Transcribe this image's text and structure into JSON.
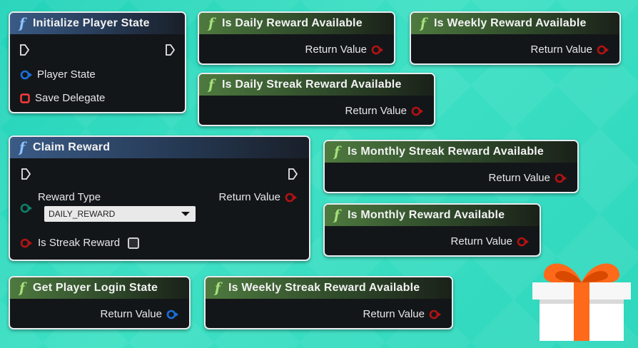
{
  "nodes": {
    "initialize_player_state": {
      "title": "Initialize Player State",
      "inputs": [
        "Player State",
        "Save Delegate"
      ]
    },
    "is_daily_reward_available": {
      "title": "Is Daily Reward Available",
      "output": "Return Value"
    },
    "is_weekly_reward_available": {
      "title": "Is Weekly Reward Available",
      "output": "Return Value"
    },
    "is_daily_streak_reward_available": {
      "title": "Is Daily Streak Reward Available",
      "output": "Return Value"
    },
    "claim_reward": {
      "title": "Claim Reward",
      "reward_type_label": "Reward Type",
      "reward_type_value": "DAILY_REWARD",
      "is_streak_label": "Is Streak Reward",
      "output": "Return Value"
    },
    "is_monthly_streak_reward_available": {
      "title": "Is Monthly Streak Reward Available",
      "output": "Return Value"
    },
    "is_monthly_reward_available": {
      "title": "Is Monthly Reward Available",
      "output": "Return Value"
    },
    "get_player_login_state": {
      "title": "Get Player Login State",
      "output": "Return Value"
    },
    "is_weekly_streak_reward_available": {
      "title": "Is Weekly Streak Reward Available",
      "output": "Return Value"
    }
  },
  "colors": {
    "bool_pin": "#b31212",
    "object_pin": "#1a6fd9",
    "enum_pin": "#0f7f6a",
    "delegate_pin": "#ff3b3b",
    "blue_header": "#3a5b86",
    "green_header": "#4e7a3f"
  },
  "icons": [
    "function-icon",
    "exec-pin-icon",
    "bool-pin-icon",
    "object-pin-icon",
    "enum-pin-icon",
    "delegate-pin-icon",
    "gift-icon"
  ]
}
